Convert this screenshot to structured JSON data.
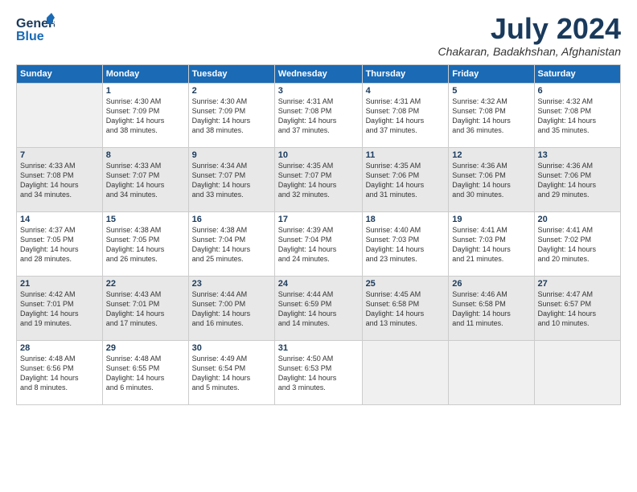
{
  "header": {
    "logo_line1": "General",
    "logo_line2": "Blue",
    "month_year": "July 2024",
    "location": "Chakaran, Badakhshan, Afghanistan"
  },
  "weekdays": [
    "Sunday",
    "Monday",
    "Tuesday",
    "Wednesday",
    "Thursday",
    "Friday",
    "Saturday"
  ],
  "weeks": [
    [
      {
        "day": "",
        "info": ""
      },
      {
        "day": "1",
        "info": "Sunrise: 4:30 AM\nSunset: 7:09 PM\nDaylight: 14 hours\nand 38 minutes."
      },
      {
        "day": "2",
        "info": "Sunrise: 4:30 AM\nSunset: 7:09 PM\nDaylight: 14 hours\nand 38 minutes."
      },
      {
        "day": "3",
        "info": "Sunrise: 4:31 AM\nSunset: 7:08 PM\nDaylight: 14 hours\nand 37 minutes."
      },
      {
        "day": "4",
        "info": "Sunrise: 4:31 AM\nSunset: 7:08 PM\nDaylight: 14 hours\nand 37 minutes."
      },
      {
        "day": "5",
        "info": "Sunrise: 4:32 AM\nSunset: 7:08 PM\nDaylight: 14 hours\nand 36 minutes."
      },
      {
        "day": "6",
        "info": "Sunrise: 4:32 AM\nSunset: 7:08 PM\nDaylight: 14 hours\nand 35 minutes."
      }
    ],
    [
      {
        "day": "7",
        "info": "Sunrise: 4:33 AM\nSunset: 7:08 PM\nDaylight: 14 hours\nand 34 minutes."
      },
      {
        "day": "8",
        "info": "Sunrise: 4:33 AM\nSunset: 7:07 PM\nDaylight: 14 hours\nand 34 minutes."
      },
      {
        "day": "9",
        "info": "Sunrise: 4:34 AM\nSunset: 7:07 PM\nDaylight: 14 hours\nand 33 minutes."
      },
      {
        "day": "10",
        "info": "Sunrise: 4:35 AM\nSunset: 7:07 PM\nDaylight: 14 hours\nand 32 minutes."
      },
      {
        "day": "11",
        "info": "Sunrise: 4:35 AM\nSunset: 7:06 PM\nDaylight: 14 hours\nand 31 minutes."
      },
      {
        "day": "12",
        "info": "Sunrise: 4:36 AM\nSunset: 7:06 PM\nDaylight: 14 hours\nand 30 minutes."
      },
      {
        "day": "13",
        "info": "Sunrise: 4:36 AM\nSunset: 7:06 PM\nDaylight: 14 hours\nand 29 minutes."
      }
    ],
    [
      {
        "day": "14",
        "info": "Sunrise: 4:37 AM\nSunset: 7:05 PM\nDaylight: 14 hours\nand 28 minutes."
      },
      {
        "day": "15",
        "info": "Sunrise: 4:38 AM\nSunset: 7:05 PM\nDaylight: 14 hours\nand 26 minutes."
      },
      {
        "day": "16",
        "info": "Sunrise: 4:38 AM\nSunset: 7:04 PM\nDaylight: 14 hours\nand 25 minutes."
      },
      {
        "day": "17",
        "info": "Sunrise: 4:39 AM\nSunset: 7:04 PM\nDaylight: 14 hours\nand 24 minutes."
      },
      {
        "day": "18",
        "info": "Sunrise: 4:40 AM\nSunset: 7:03 PM\nDaylight: 14 hours\nand 23 minutes."
      },
      {
        "day": "19",
        "info": "Sunrise: 4:41 AM\nSunset: 7:03 PM\nDaylight: 14 hours\nand 21 minutes."
      },
      {
        "day": "20",
        "info": "Sunrise: 4:41 AM\nSunset: 7:02 PM\nDaylight: 14 hours\nand 20 minutes."
      }
    ],
    [
      {
        "day": "21",
        "info": "Sunrise: 4:42 AM\nSunset: 7:01 PM\nDaylight: 14 hours\nand 19 minutes."
      },
      {
        "day": "22",
        "info": "Sunrise: 4:43 AM\nSunset: 7:01 PM\nDaylight: 14 hours\nand 17 minutes."
      },
      {
        "day": "23",
        "info": "Sunrise: 4:44 AM\nSunset: 7:00 PM\nDaylight: 14 hours\nand 16 minutes."
      },
      {
        "day": "24",
        "info": "Sunrise: 4:44 AM\nSunset: 6:59 PM\nDaylight: 14 hours\nand 14 minutes."
      },
      {
        "day": "25",
        "info": "Sunrise: 4:45 AM\nSunset: 6:58 PM\nDaylight: 14 hours\nand 13 minutes."
      },
      {
        "day": "26",
        "info": "Sunrise: 4:46 AM\nSunset: 6:58 PM\nDaylight: 14 hours\nand 11 minutes."
      },
      {
        "day": "27",
        "info": "Sunrise: 4:47 AM\nSunset: 6:57 PM\nDaylight: 14 hours\nand 10 minutes."
      }
    ],
    [
      {
        "day": "28",
        "info": "Sunrise: 4:48 AM\nSunset: 6:56 PM\nDaylight: 14 hours\nand 8 minutes."
      },
      {
        "day": "29",
        "info": "Sunrise: 4:48 AM\nSunset: 6:55 PM\nDaylight: 14 hours\nand 6 minutes."
      },
      {
        "day": "30",
        "info": "Sunrise: 4:49 AM\nSunset: 6:54 PM\nDaylight: 14 hours\nand 5 minutes."
      },
      {
        "day": "31",
        "info": "Sunrise: 4:50 AM\nSunset: 6:53 PM\nDaylight: 14 hours\nand 3 minutes."
      },
      {
        "day": "",
        "info": ""
      },
      {
        "day": "",
        "info": ""
      },
      {
        "day": "",
        "info": ""
      }
    ]
  ]
}
